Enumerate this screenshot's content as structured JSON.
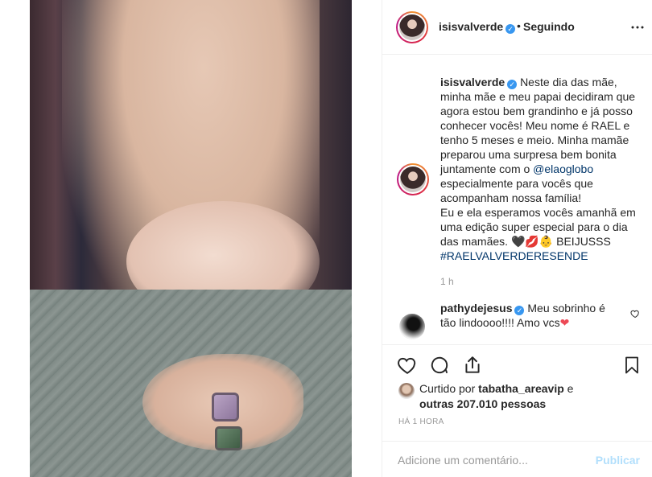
{
  "header": {
    "username": "isisvalverde",
    "separator": "•",
    "following_label": "Seguindo",
    "more_icon": "more-horizontal-icon"
  },
  "caption": {
    "username": "isisvalverde",
    "text_1": "Neste dia das mãe, minha mãe e meu papai decidiram que agora estou bem grandinho e já posso conhecer vocês! Meu nome é RAEL e tenho 5 meses e meio. Minha mamãe preparou uma surpresa bem bonita juntamente com o ",
    "mention": "@elaoglobo",
    "text_2": " especialmente para vocês que acompanham nossa família!\nEu e ela esperamos vocês amanhã em uma edição super especial para o dia das mamães. ",
    "emojis": "🖤💋👶",
    "text_3": " BEIJUSSS",
    "hashtag": "#RAELVALVERDERESENDE",
    "time": "1 h"
  },
  "comment": {
    "username": "pathydejesus",
    "text": "Meu sobrinho é tão lindoooo!!!! Amo vcs",
    "heart": "❤"
  },
  "actions": {
    "like_icon": "heart-icon",
    "comment_icon": "comment-icon",
    "share_icon": "share-icon",
    "save_icon": "bookmark-icon"
  },
  "likes": {
    "prefix": "Curtido por ",
    "user": "tabatha_areavip",
    "middle": " e",
    "others": "outras 207.010 pessoas"
  },
  "posted_ago": "HÁ 1 HORA",
  "add_comment": {
    "placeholder": "Adicione um comentário...",
    "publish_label": "Publicar"
  },
  "colors": {
    "verified": "#3897f0",
    "link": "#003569",
    "publish_disabled": "#b2dffc",
    "heart": "#ed4956"
  }
}
